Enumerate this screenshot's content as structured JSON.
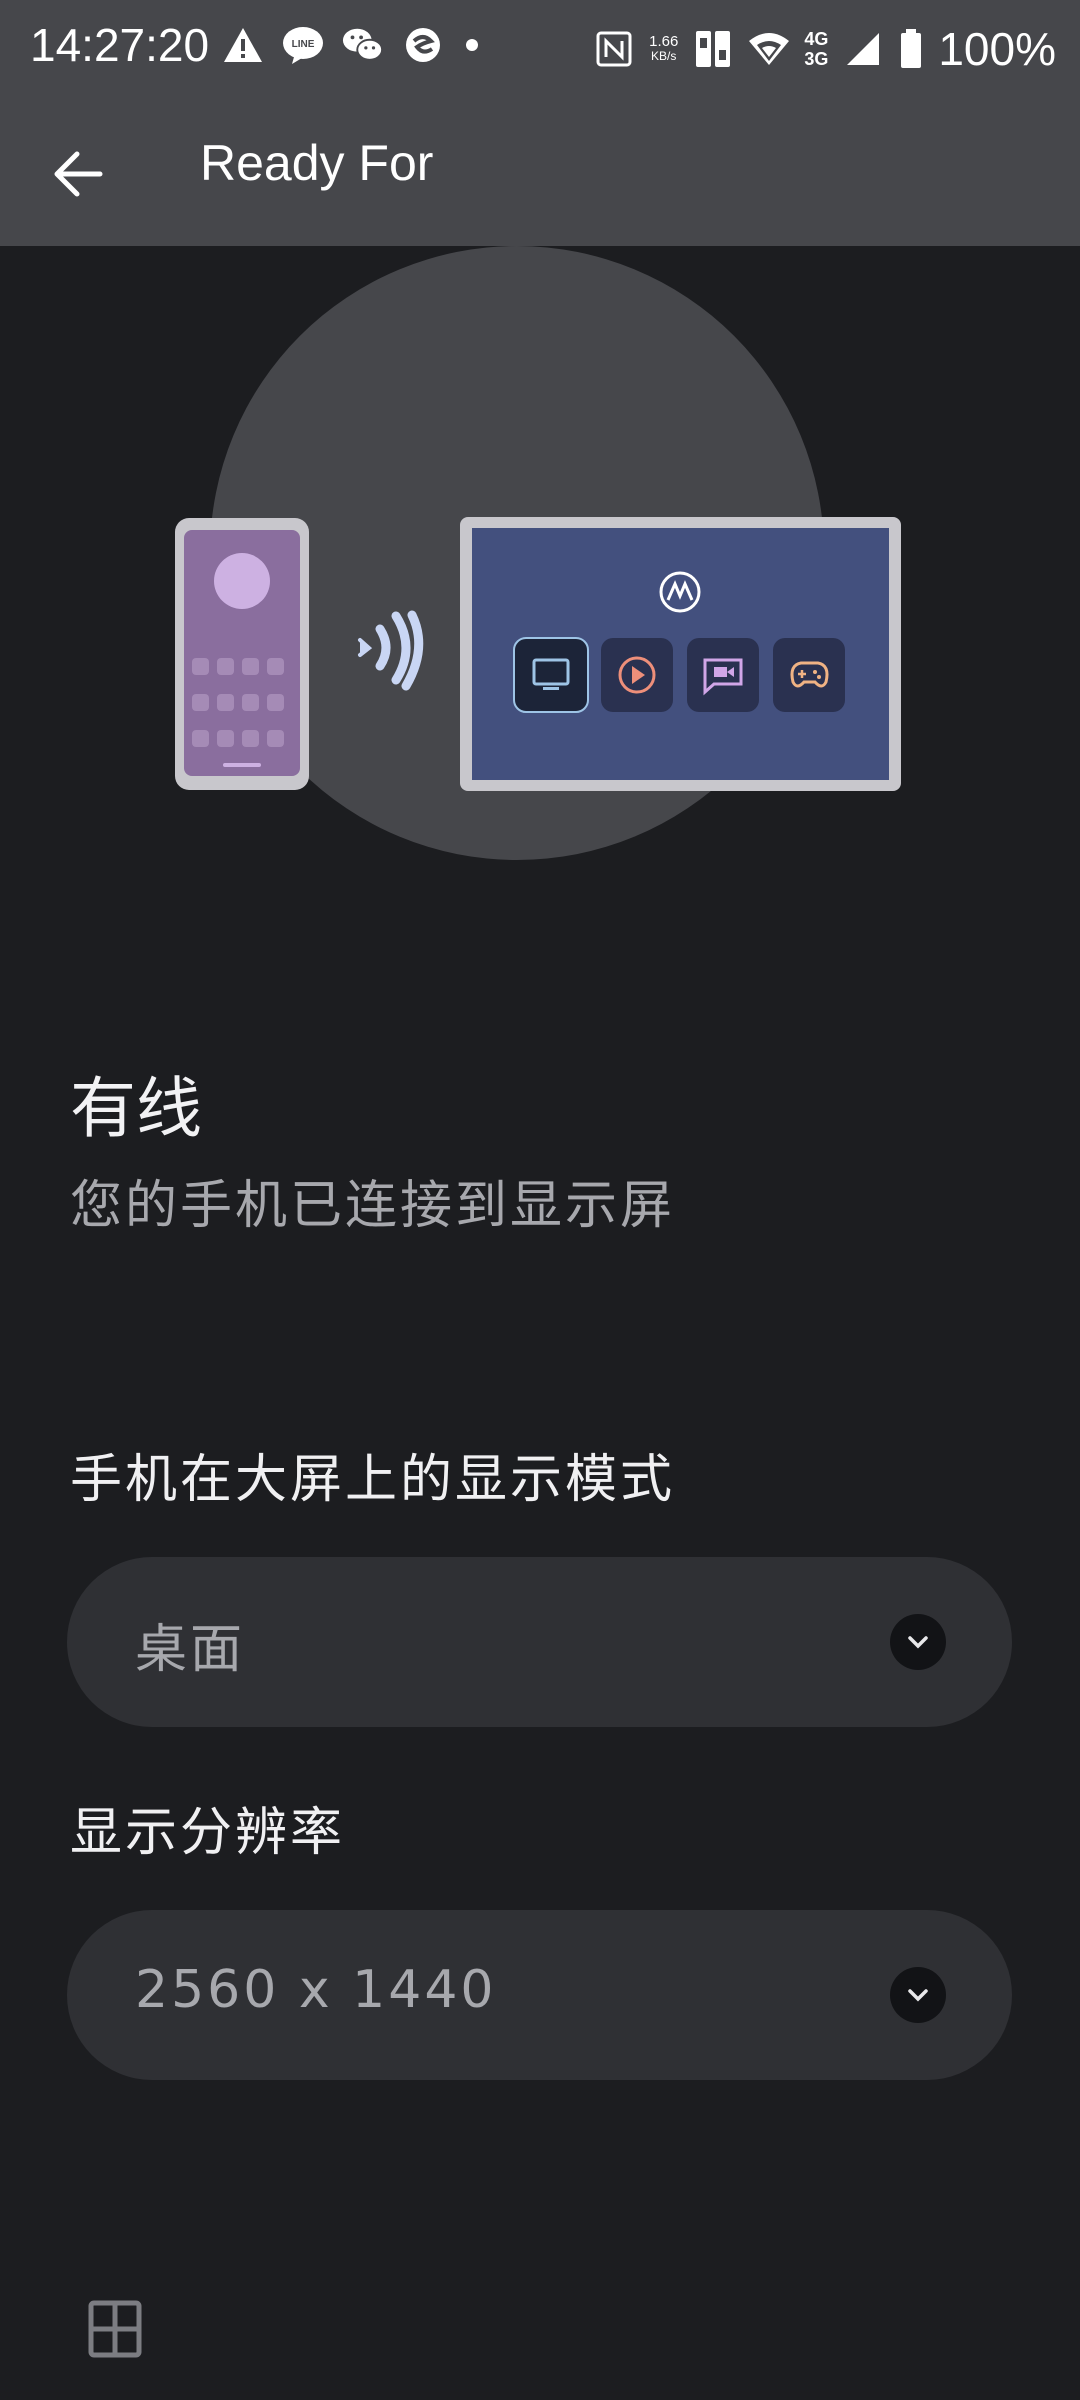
{
  "status_bar": {
    "time": "14:27:20",
    "net_speed_value": "1.66",
    "net_speed_unit": "KB/s",
    "network_4g": "4G",
    "network_3g": "3G",
    "battery": "100%",
    "icons": [
      "alert-icon",
      "line-app-icon",
      "wechat-icon",
      "edge-app-icon",
      "dot-icon",
      "nfc-icon",
      "dual-sim-icon",
      "wifi-icon",
      "signal-icon",
      "battery-icon"
    ]
  },
  "app_bar": {
    "title": "Ready For"
  },
  "connection": {
    "title": "有线",
    "subtitle": "您的手机已连接到显示屏"
  },
  "display_mode": {
    "label": "手机在大屏上的显示模式",
    "value": "桌面"
  },
  "resolution": {
    "label": "显示分辨率",
    "value": "2560 x 1440"
  },
  "colors": {
    "background": "#1c1d20",
    "header": "#46474b",
    "dropdown": "#2f3034",
    "monitor_screen": "#43507e",
    "phone_screen": "#8a6e9e"
  }
}
